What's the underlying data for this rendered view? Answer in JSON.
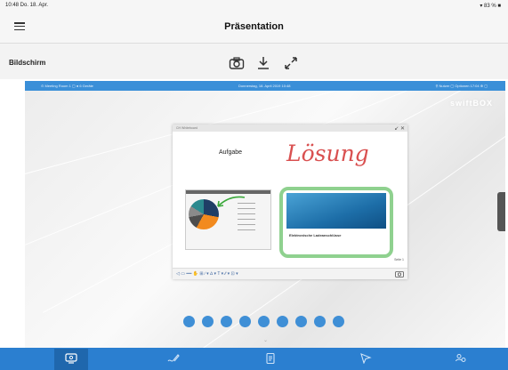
{
  "status_bar": {
    "time": "10:48  Do. 18. Apr.",
    "battery": "▾ 83 % ■"
  },
  "header": {
    "title": "Präsentation"
  },
  "subbar": {
    "label": "Bildschirm"
  },
  "screen": {
    "bar_left": "⊙ Meeting Room 1  ▢ ● 6 Geräte",
    "bar_center": "Donnerstag, 18. April 2019  10:48",
    "bar_right": "⚲ Nutzer  ▢ Optionen  17:04  ⊕  ▢",
    "brand": "swiftBOX"
  },
  "window": {
    "title": "CH Whiteboard",
    "controls": "↙ ✕",
    "task_label": "Aufgabe",
    "solution_label": "Lösung",
    "caption_title": "Elektronische Ladeanschlüsse",
    "toolbar": "◁ ▭ ━━  ✋  ⊞  ∕ ▾  ∆ ▾  T ▾  ∕∕ ▾  ⊡ ▾",
    "page": "Seite 1"
  },
  "accent": "#2b7fd0"
}
